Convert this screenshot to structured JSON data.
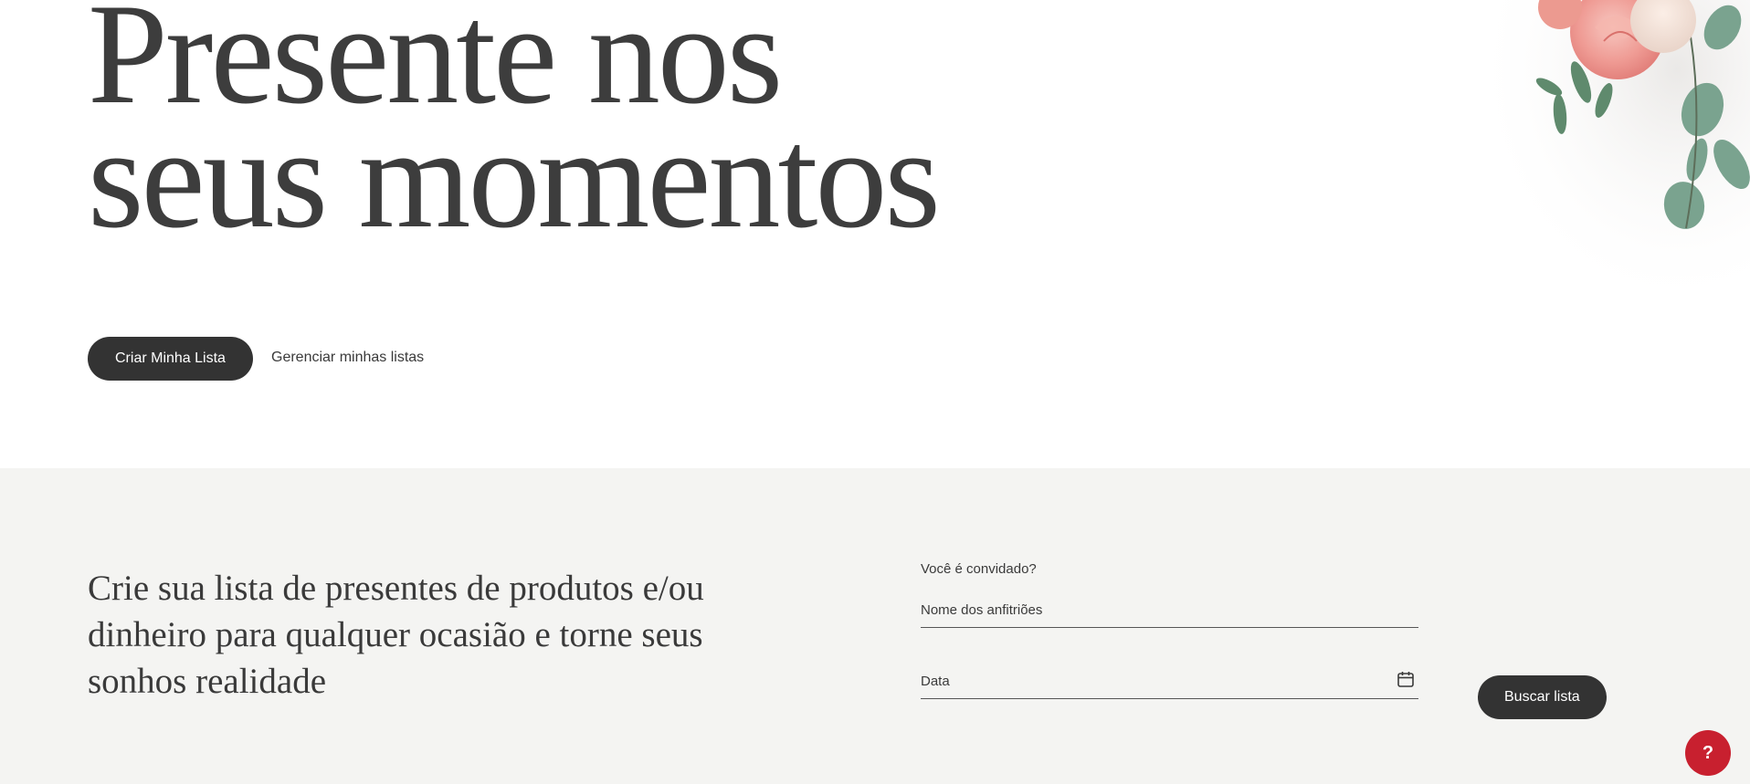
{
  "hero": {
    "title_line1": "Presente nos",
    "title_line2": "seus momentos",
    "primary_button_label": "Criar Minha Lista",
    "secondary_link_label": "Gerenciar minhas listas"
  },
  "guest_section": {
    "description": "Crie sua lista de presentes de produtos e/ou dinheiro para qualquer ocasião e torne seus sonhos realidade",
    "form_label": "Você é convidado?",
    "host_name_placeholder": "Nome dos anfitriões",
    "date_placeholder": "Data",
    "calendar_icon": "calendar-icon",
    "search_button_label": "Buscar lista"
  },
  "help": {
    "label": "?",
    "color": "#c8202f"
  },
  "colors": {
    "dark_button": "#333333",
    "section_background": "#f4f4f2",
    "text": "#3a3a3a"
  }
}
